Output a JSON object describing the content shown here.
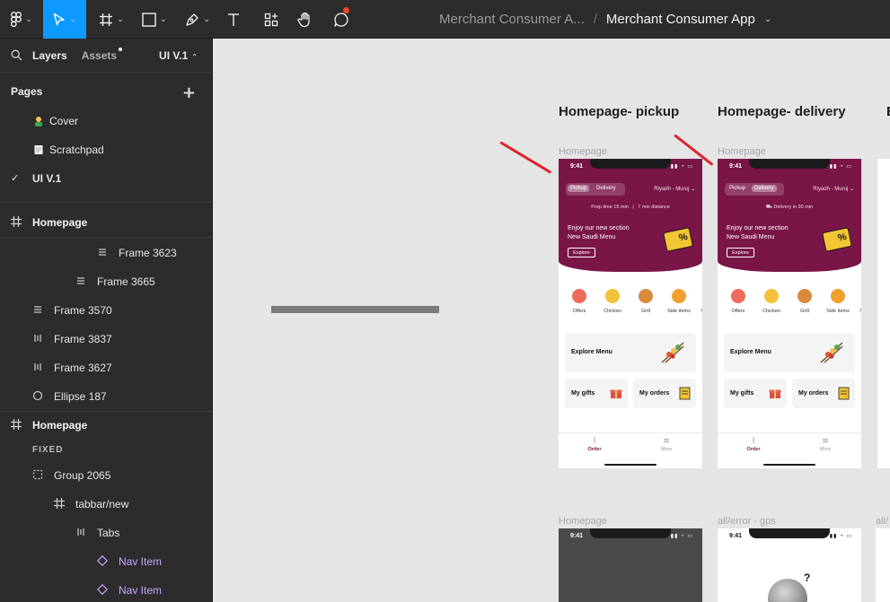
{
  "toolbar": {
    "tools": [
      {
        "name": "figma-menu-icon"
      },
      {
        "name": "move-tool-icon",
        "active": true
      },
      {
        "name": "frame-tool-icon"
      },
      {
        "name": "shape-tool-icon"
      },
      {
        "name": "pen-tool-icon"
      },
      {
        "name": "text-tool-icon"
      },
      {
        "name": "resources-icon"
      },
      {
        "name": "hand-tool-icon"
      },
      {
        "name": "comment-icon"
      }
    ],
    "breadcrumb_parent": "Merchant Consumer A...",
    "breadcrumb_separator": "/",
    "file_title": "Merchant Consumer App",
    "accent_color": "#0d99ff",
    "notification_color": "#f24822"
  },
  "left_panel": {
    "tab_layers": "Layers",
    "tab_assets": "Assets",
    "version": "UI V.1",
    "pages_heading": "Pages",
    "pages": [
      {
        "label": "Cover",
        "icon": "person-emoji-icon"
      },
      {
        "label": "Scratchpad",
        "icon": "memo-emoji-icon"
      },
      {
        "label": "UI V.1",
        "selected": true
      }
    ],
    "layers": [
      {
        "label": "Homepage",
        "icon": "frame-icon"
      },
      {
        "label": "Frame 3623",
        "icon": "vertical-stack-icon"
      },
      {
        "label": "Frame 3665",
        "icon": "vertical-stack-icon"
      },
      {
        "label": "Frame 3570",
        "icon": "vertical-stack-icon"
      },
      {
        "label": "Frame 3837",
        "icon": "horizontal-stack-icon"
      },
      {
        "label": "Frame 3627",
        "icon": "horizontal-stack-icon"
      },
      {
        "label": "Ellipse 187",
        "icon": "ellipse-icon"
      },
      {
        "label": "Homepage",
        "icon": "frame-icon"
      },
      {
        "label": "FIXED"
      },
      {
        "label": "Group 2065",
        "icon": "group-icon"
      },
      {
        "label": "tabbar/new",
        "icon": "frame-icon"
      },
      {
        "label": "Tabs",
        "icon": "horizontal-stack-icon"
      },
      {
        "label": "Nav Item",
        "icon": "component-instance-icon"
      },
      {
        "label": "Nav Item",
        "icon": "component-instance-icon"
      }
    ]
  },
  "canvas": {
    "frames": [
      {
        "title": "Homepage- pickup",
        "label": "Homepage",
        "status_time": "9:41",
        "seg_pickup": "Pickup",
        "seg_delivery": "Delivery",
        "location": "Riyadh - Muruj",
        "meta_left": "Prep time 15 min",
        "meta_sep": "|",
        "meta_right": "7 min distance",
        "promo_line1": "Enjoy our new section",
        "promo_line2": "New Saudi Menu",
        "explore_btn": "Explore",
        "ticket_text": "%",
        "categories": [
          "Offers",
          "Chicken",
          "Grill",
          "Side items",
          "S"
        ],
        "explore_menu": "Explore Menu",
        "my_gifts": "My gifts",
        "my_orders": "My orders",
        "tab_order": "Order",
        "tab_more": "More"
      },
      {
        "title": "Homepage- delivery",
        "label": "Homepage",
        "status_time": "9:41",
        "seg_pickup": "Pickup",
        "seg_delivery": "Delivery",
        "location": "Riyadh - Muruj",
        "meta_center": "Delivery in 30 min",
        "promo_line1": "Enjoy our new section",
        "promo_line2": "New Saudi Menu",
        "explore_btn": "Explore",
        "ticket_text": "%",
        "categories": [
          "Offers",
          "Chicken",
          "Grill",
          "Side items",
          "S"
        ],
        "explore_menu": "Explore Menu",
        "my_gifts": "My gifts",
        "my_orders": "My orders",
        "tab_order": "Order",
        "tab_more": "More"
      }
    ],
    "third_frame_title": "E",
    "lower_labels": [
      "Homepage",
      "all/error - gps",
      "all/"
    ],
    "lower_time_1": "9:41",
    "lower_time_2": "9:41",
    "question_marks": "?",
    "brand_color": "#7a1548"
  }
}
